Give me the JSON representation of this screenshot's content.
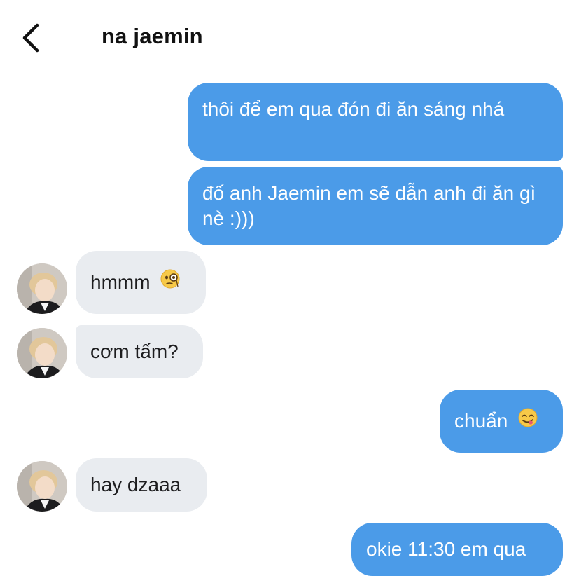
{
  "header": {
    "back_icon": "chevron-left-icon",
    "title": "na jaemin"
  },
  "colors": {
    "sent_bubble": "#4b9be8",
    "received_bubble": "#e9ecf0",
    "background": "#ffffff"
  },
  "messages": [
    {
      "from": "me",
      "text": "thôi để em qua đón đi ăn sáng nhá"
    },
    {
      "from": "me",
      "text": "đố anh Jaemin em sẽ dẫn anh đi ăn gì nè :)))"
    },
    {
      "from": "na jaemin",
      "text": "hmmm",
      "emoji": "monocle-face-emoji"
    },
    {
      "from": "na jaemin",
      "text": "cơm tấm?"
    },
    {
      "from": "me",
      "text": "chuẩn",
      "emoji": "savoring-food-emoji"
    },
    {
      "from": "na jaemin",
      "text": "hay dzaaa"
    },
    {
      "from": "me",
      "text": "okie 11:30 em qua"
    }
  ]
}
